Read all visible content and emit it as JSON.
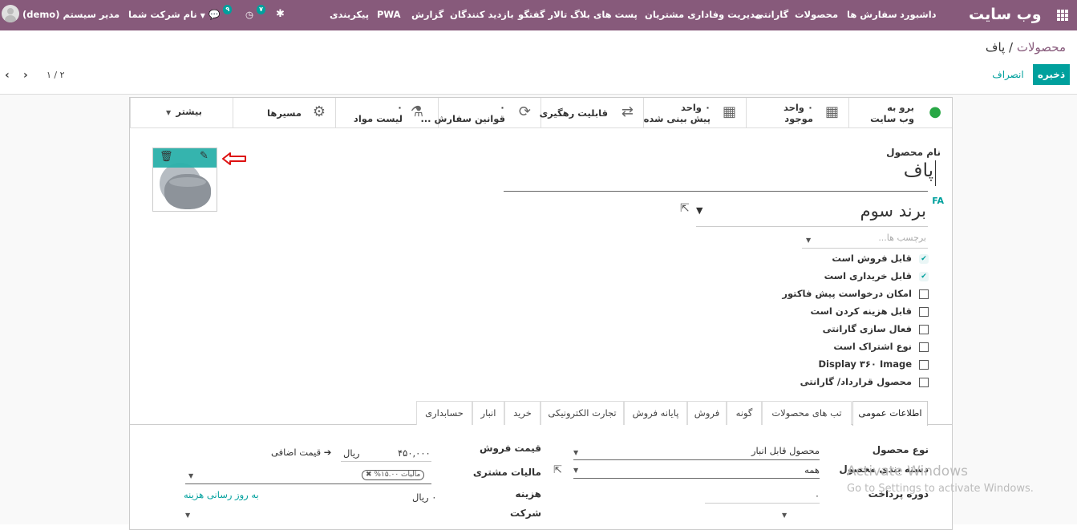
{
  "topbar": {
    "brand": "وب سایت",
    "menu": [
      "داشبورد",
      "سفارش ها",
      "محصولات",
      "گارانتی",
      "مدیریت وفاداری مشتریان",
      "پست های بلاگ",
      "تالار گفتگو",
      "بازدید کنندگان",
      "گزارش",
      "PWA",
      "پیکربندی"
    ],
    "company": "نام شرکت شما",
    "user": "مدیر سیستم (demo)",
    "chat_count": "۹",
    "activity_count": "۷"
  },
  "breadcrumb": {
    "parent": "محصولات",
    "separator": "/",
    "current": "پاف"
  },
  "actions": {
    "save": "ذخیره",
    "discard": "انصراف"
  },
  "pager": {
    "value": "۱ / ۲"
  },
  "smart_buttons": {
    "website": {
      "line1": "برو به",
      "line2": "وب سایت"
    },
    "onhand": {
      "line1": "۰ واحد",
      "line2": "موجود"
    },
    "forecast": {
      "line1": "۰ واحد",
      "line2": "پیش بینی شده"
    },
    "traceability": "قابلیت رهگیری",
    "reorder": {
      "line1": "۰",
      "line2": "قوانین سفارش ..."
    },
    "bom": {
      "line1": "۰",
      "line2": "لیست مواد"
    },
    "routes": "مسیرها",
    "more": "بیشتر"
  },
  "form": {
    "name_label": "نام محصول",
    "name_value": "پاف",
    "lang": "FA",
    "brand_value": "برند سوم",
    "tags_placeholder": "برچسب ها...",
    "checkboxes": [
      {
        "label": "قابل فروش است",
        "checked": true
      },
      {
        "label": "قابل خریداری است",
        "checked": true
      },
      {
        "label": "امکان درخواست پیش فاکتور",
        "checked": false
      },
      {
        "label": "قابل هزینه کردن است",
        "checked": false
      },
      {
        "label": "فعال سازی گارانتی",
        "checked": false
      },
      {
        "label": "نوع اشتراک است",
        "checked": false
      },
      {
        "label": "Display ۳۶۰ Image",
        "checked": false
      },
      {
        "label": "محصول قرارداد/ گارانتی",
        "checked": false
      }
    ]
  },
  "tabs": [
    "اطلاعات عمومی",
    "تب های محصولات",
    "گونه",
    "فروش",
    "پایانه فروش",
    "تجارت الکترونیکی",
    "خرید",
    "انبار",
    "حسابداری"
  ],
  "general": {
    "product_type_label": "نوع محصول",
    "product_type_value": "محصول قابل انبار",
    "category_label": "دسته بندی محصول",
    "category_value": "همه",
    "payment_label": "دوره پرداخت",
    "payment_value": "۰",
    "sale_price_label": "قیمت فروش",
    "sale_price_value": "۴۵۰,۰۰۰",
    "currency": "ریال",
    "extra_price": "قیمت اضافی",
    "tax_label": "مالیات مشتری",
    "tax_value": "مالیات ۱۵.۰۰%",
    "cost_label": "هزینه",
    "cost_value": "۰ ریال",
    "update_cost": "به روز رسانی هزینه",
    "company_label": "شرکت"
  },
  "watermark": {
    "line1": "Activate Windows",
    "line2": "Go to Settings to activate Windows."
  }
}
